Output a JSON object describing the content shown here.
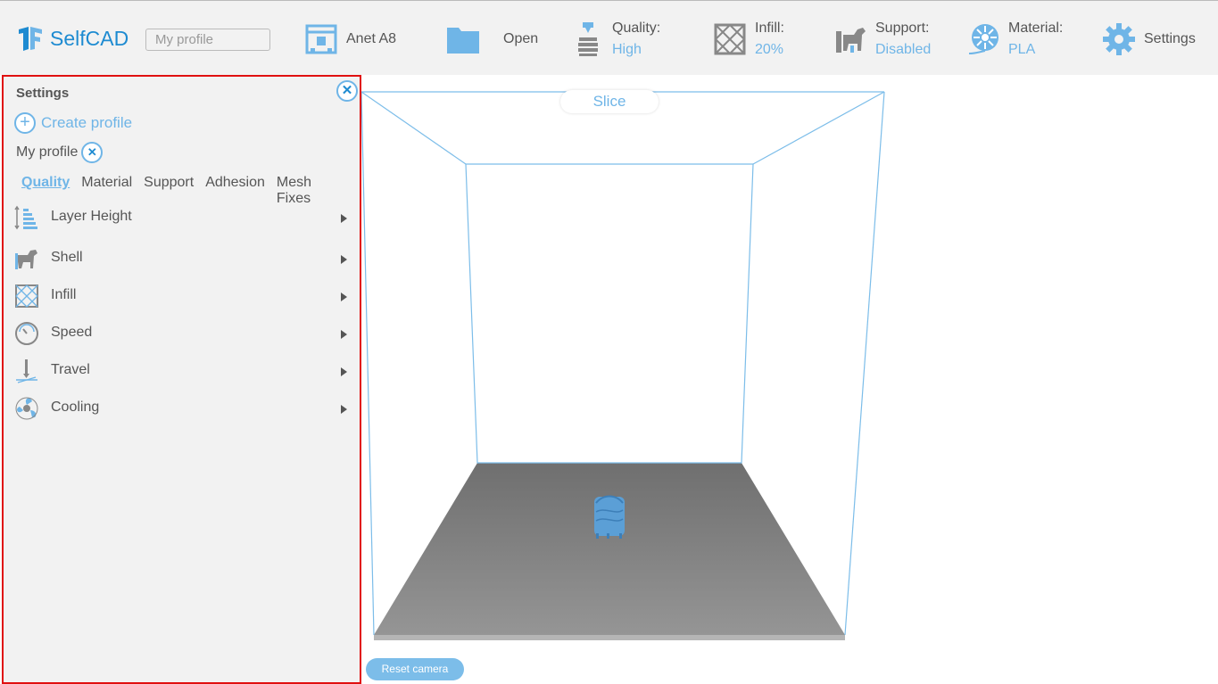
{
  "brand": {
    "name_prefix": "Self",
    "name_suffix": "CAD"
  },
  "header": {
    "profile_input": {
      "value": "My profile",
      "placeholder": "My profile"
    },
    "printer": {
      "label": "Anet A8",
      "icon": "printer-icon"
    },
    "open": {
      "label": "Open",
      "icon": "folder-icon"
    },
    "quality": {
      "key": "Quality:",
      "value": "High",
      "icon": "quality-icon"
    },
    "infill": {
      "key": "Infill:",
      "value": "20%",
      "icon": "infill-icon"
    },
    "support": {
      "key": "Support:",
      "value": "Disabled",
      "icon": "support-icon"
    },
    "material": {
      "key": "Material:",
      "value": "PLA",
      "icon": "material-icon"
    },
    "settings": {
      "label": "Settings",
      "icon": "gear-icon"
    }
  },
  "viewport": {
    "slice_label": "Slice",
    "reset_camera_label": "Reset camera"
  },
  "panel": {
    "title": "Settings",
    "create_profile": "Create profile",
    "profile_name": "My profile",
    "tabs": [
      {
        "label": "Quality",
        "active": true
      },
      {
        "label": "Material",
        "active": false
      },
      {
        "label": "Support",
        "active": false
      },
      {
        "label": "Adhesion",
        "active": false
      },
      {
        "label": "Mesh Fixes",
        "active": false
      }
    ],
    "items": [
      {
        "label": "Layer Height",
        "icon": "layer-height-icon"
      },
      {
        "label": "Shell",
        "icon": "shell-icon"
      },
      {
        "label": "Infill",
        "icon": "infill-icon"
      },
      {
        "label": "Speed",
        "icon": "speed-icon"
      },
      {
        "label": "Travel",
        "icon": "travel-icon"
      },
      {
        "label": "Cooling",
        "icon": "cooling-icon"
      }
    ]
  },
  "colors": {
    "accent": "#6fb5e7",
    "brand": "#1e8bd1",
    "panel_border": "#e01010"
  }
}
